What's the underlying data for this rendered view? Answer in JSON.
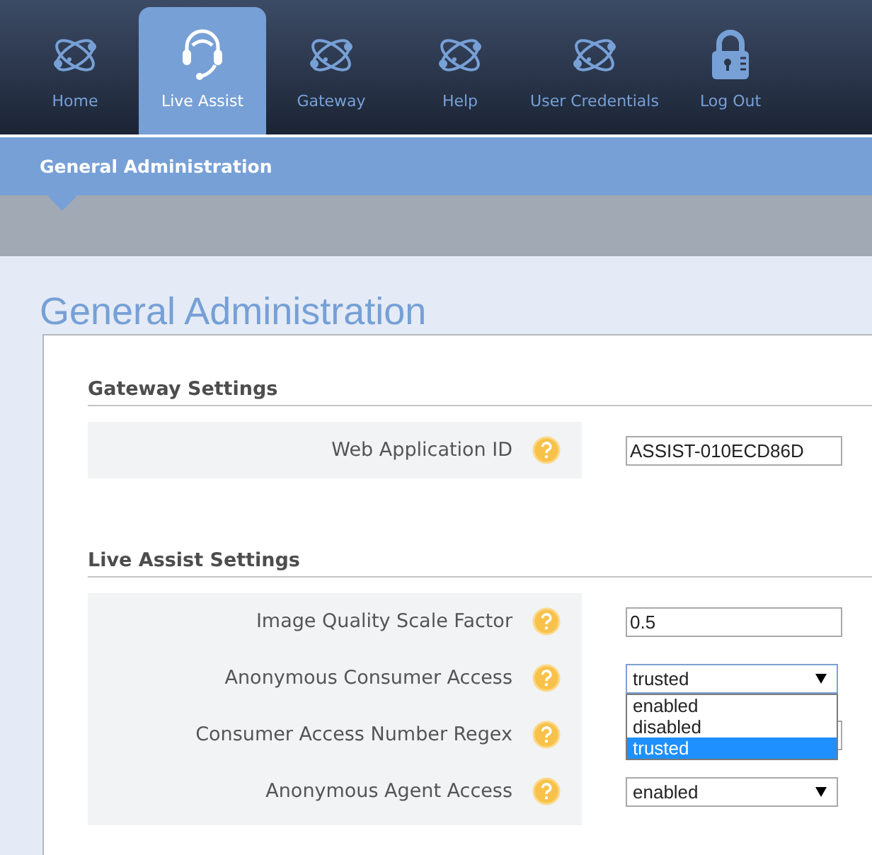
{
  "nav": {
    "tabs": [
      {
        "label": "Home",
        "kind": "atom",
        "selected": false
      },
      {
        "label": "Live Assist",
        "kind": "headset",
        "selected": true
      },
      {
        "label": "Gateway",
        "kind": "atom",
        "selected": false
      },
      {
        "label": "Help",
        "kind": "atom",
        "selected": false
      },
      {
        "label": "User Credentials",
        "kind": "atom",
        "selected": false
      },
      {
        "label": "Log Out",
        "kind": "lock",
        "selected": false
      }
    ]
  },
  "subnav": {
    "items": [
      {
        "label": "General Administration",
        "selected": true
      }
    ]
  },
  "page_title": "General Administration",
  "sections": [
    {
      "heading": "Gateway Settings",
      "fields": [
        {
          "label": "Web Application ID",
          "kind": "text",
          "value": "ASSIST-010ECD86D"
        }
      ]
    },
    {
      "heading": "Live Assist Settings",
      "fields": [
        {
          "label": "Image Quality Scale Factor",
          "kind": "text",
          "value": "0.5"
        },
        {
          "label": "Anonymous Consumer Access",
          "kind": "select",
          "value": "trusted",
          "expanded": true,
          "options": [
            {
              "label": "enabled",
              "selected": false
            },
            {
              "label": "disabled",
              "selected": false
            },
            {
              "label": "trusted",
              "selected": true
            }
          ]
        },
        {
          "label": "Consumer Access Number Regex",
          "kind": "text"
        },
        {
          "label": "Anonymous Agent Access",
          "kind": "select",
          "value": "enabled",
          "expanded": false
        }
      ]
    }
  ]
}
